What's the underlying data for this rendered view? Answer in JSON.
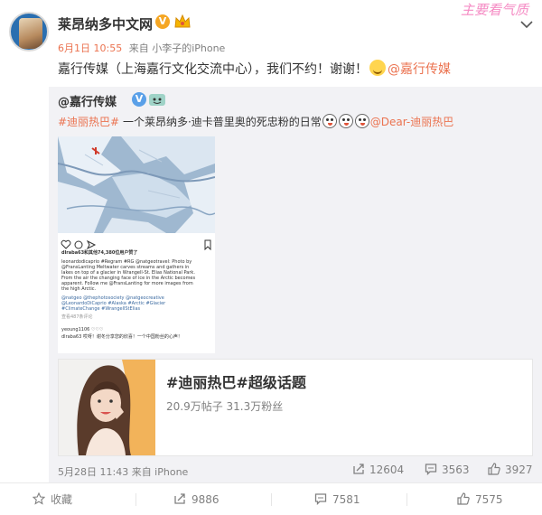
{
  "header": {
    "author": "莱昂纳多中文网",
    "watermark": "主要看气质",
    "time": "6月1日 10:55",
    "source": "来自 小李子的iPhone",
    "text_before": "嘉行传媒（上海嘉行文化交流中心），我们不约！谢谢！",
    "mention": "@嘉行传媒"
  },
  "repost": {
    "author": "@嘉行传媒",
    "topic": "#迪丽热巴#",
    "text": " 一个莱昂纳多·迪卡普里奥的死忠粉的日常",
    "mention": "@Dear-迪丽热巴",
    "instagram": {
      "likes": "dlraba63和其他74,380位用户赞了",
      "caption_lines": [
        "leonardodicaprio #Regram #RG @natgeotravel: Photo by",
        "@FransLanting Meltwater carves streams and gathers in",
        "lakes on top of a glacier in Wrangell-St. Elias National Park.",
        "From the air the changing face of ice in the Arctic becomes",
        "apparent. Follow me @FransLanting for more images from",
        "the high Arctic."
      ],
      "tag_lines": [
        "@natgeo @thephotosociety @natgeocreative",
        "@LeonardoDiCaprio #Alaska #Arctic #Glacier",
        "#ClimateChange #WrangellStElias"
      ],
      "view_comments": "查看487条评论",
      "comment_1": "yeoung1106 ♡♡♡",
      "comment_2": "dlraba63 哎呀！谢冬分享您的欣喜！一个中国粉丝的心声！"
    },
    "topic_card": {
      "title": "#迪丽热巴#超级话题",
      "stats": "20.9万帖子  31.3万粉丝"
    },
    "footer": {
      "meta": "5月28日 11:43 来自 iPhone",
      "reposts": "12604",
      "comments": "3563",
      "likes": "3927"
    }
  },
  "actions": {
    "favorite": "收藏",
    "reposts": "9886",
    "comments": "7581",
    "likes": "7575"
  },
  "colors": {
    "accent": "#eb7350",
    "muted": "#808080",
    "repost_bg": "#f2f2f5"
  }
}
